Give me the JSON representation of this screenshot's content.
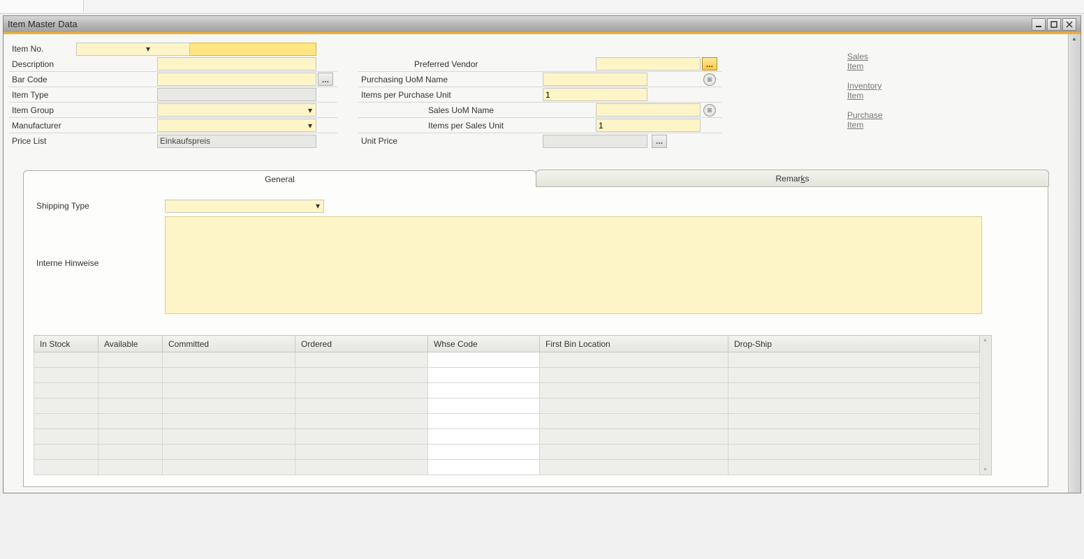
{
  "window": {
    "title": "Item Master Data"
  },
  "left": {
    "item_no_label": "Item No.",
    "description_label": "Description",
    "bar_code_label": "Bar Code",
    "item_type_label": "Item Type",
    "item_group_label": "Item Group",
    "manufacturer_label": "Manufacturer",
    "price_list_label": "Price List",
    "price_list_value": "Einkaufspreis"
  },
  "mid": {
    "preferred_vendor_label": "Preferred Vendor",
    "purchasing_uom_label": "Purchasing UoM Name",
    "items_per_purchase_label": "Items per Purchase Unit",
    "items_per_purchase_value": "1",
    "sales_uom_label": "Sales UoM Name",
    "items_per_sales_label": "Items per Sales Unit",
    "items_per_sales_value": "1",
    "unit_price_label": "Unit Price"
  },
  "right": {
    "sales_item": "Sales Item",
    "inventory_item": "Inventory Item",
    "purchase_item": "Purchase Item"
  },
  "tabs": {
    "general": "General",
    "remarks": "Remarks"
  },
  "general_tab": {
    "shipping_type_label": "Shipping Type",
    "internal_notes_label": "Interne Hinweise"
  },
  "grid": {
    "headers": {
      "in_stock": "In Stock",
      "available": "Available",
      "committed": "Committed",
      "ordered": "Ordered",
      "whse_code": "Whse Code",
      "first_bin": "First Bin Location",
      "drop_ship": "Drop-Ship"
    },
    "row_count": 8
  },
  "icons": {
    "ellipsis": "...",
    "list": "≡"
  }
}
